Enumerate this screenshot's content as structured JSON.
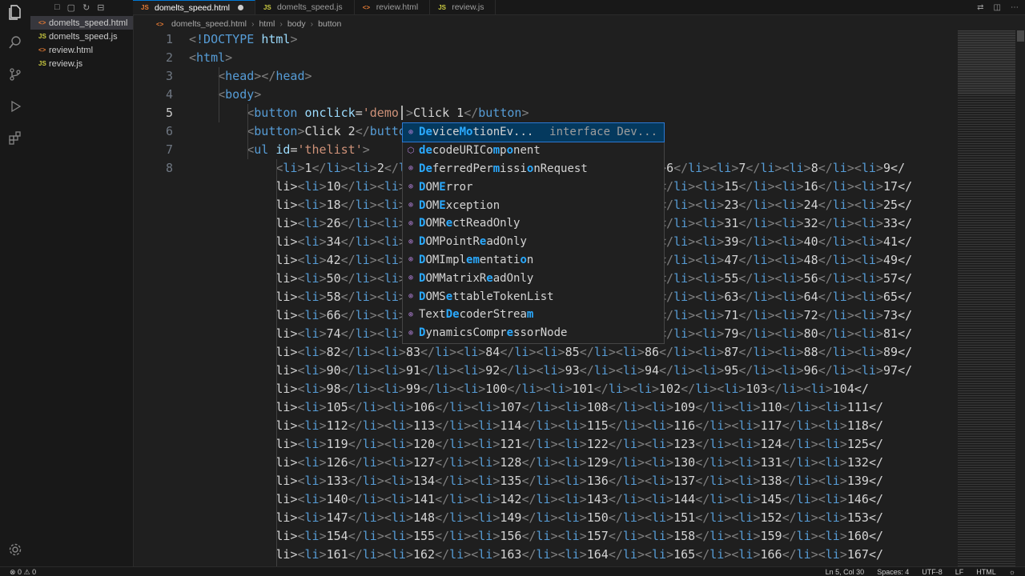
{
  "editor_tabs": [
    {
      "icon": "JS",
      "label": "domelts_speed.html",
      "active": true,
      "unsaved": true
    },
    {
      "icon": "JS",
      "label": "domelts_speed.js"
    },
    {
      "icon": "<>",
      "label": "review.html"
    },
    {
      "icon": "JS",
      "label": "review.js"
    }
  ],
  "explorer": {
    "files": [
      {
        "icon": "<>",
        "label": "domelts_speed.html",
        "active": true
      },
      {
        "icon": "JS",
        "label": "domelts_speed.js"
      },
      {
        "icon": "<>",
        "label": "review.html"
      },
      {
        "icon": "JS",
        "label": "review.js"
      }
    ]
  },
  "breadcrumb": {
    "file": "domelts_speed.html",
    "items": [
      "html",
      "body",
      "button"
    ]
  },
  "code_lines": [
    {
      "n": "1",
      "text": "<!DOCTYPE html>"
    },
    {
      "n": "2",
      "text": "<html>"
    },
    {
      "n": "3",
      "text": "    <head></head>"
    },
    {
      "n": "4",
      "text": "    <body>"
    },
    {
      "n": "5",
      "text": "        <button onclick='demo'>Click 1</button>"
    },
    {
      "n": "6",
      "text": "        <button>Click 2</button>"
    },
    {
      "n": "7",
      "text": "        <ul id='thelist'>"
    },
    {
      "n": "8",
      "text": "            <li>1</li><li>2</li><li>3</li><li>4</li><li>5</li><li>6</li><li>7</li><li>8</li><li>9</"
    },
    {
      "n": "",
      "text": "            li><li>10</li><li>11</li><li>12</li><li>13</li><li>14</li><li>15</li><li>16</li><li>17</"
    },
    {
      "n": "",
      "text": "            li><li>18</li><li>19</li><li>20</li><li>21</li><li>22</li><li>23</li><li>24</li><li>25</"
    },
    {
      "n": "",
      "text": "            li><li>26</li><li>27</li><li>28</li><li>29</li><li>30</li><li>31</li><li>32</li><li>33</"
    },
    {
      "n": "",
      "text": "            li><li>34</li><li>35</li><li>36</li><li>37</li><li>38</li><li>39</li><li>40</li><li>41</"
    },
    {
      "n": "",
      "text": "            li><li>42</li><li>43</li><li>44</li><li>45</li><li>46</li><li>47</li><li>48</li><li>49</"
    },
    {
      "n": "",
      "text": "            li><li>50</li><li>51</li><li>52</li><li>53</li><li>54</li><li>55</li><li>56</li><li>57</"
    },
    {
      "n": "",
      "text": "            li><li>58</li><li>59</li><li>60</li><li>61</li><li>62</li><li>63</li><li>64</li><li>65</"
    },
    {
      "n": "",
      "text": "            li><li>66</li><li>67</li><li>68</li><li>69</li><li>70</li><li>71</li><li>72</li><li>73</"
    },
    {
      "n": "",
      "text": "            li><li>74</li><li>75</li><li>76</li><li>77</li><li>78</li><li>79</li><li>80</li><li>81</"
    },
    {
      "n": "",
      "text": "            li><li>82</li><li>83</li><li>84</li><li>85</li><li>86</li><li>87</li><li>88</li><li>89</"
    },
    {
      "n": "",
      "text": "            li><li>90</li><li>91</li><li>92</li><li>93</li><li>94</li><li>95</li><li>96</li><li>97</"
    },
    {
      "n": "",
      "text": "            li><li>98</li><li>99</li><li>100</li><li>101</li><li>102</li><li>103</li><li>104</"
    },
    {
      "n": "",
      "text": "            li><li>105</li><li>106</li><li>107</li><li>108</li><li>109</li><li>110</li><li>111</"
    },
    {
      "n": "",
      "text": "            li><li>112</li><li>113</li><li>114</li><li>115</li><li>116</li><li>117</li><li>118</"
    },
    {
      "n": "",
      "text": "            li><li>119</li><li>120</li><li>121</li><li>122</li><li>123</li><li>124</li><li>125</"
    },
    {
      "n": "",
      "text": "            li><li>126</li><li>127</li><li>128</li><li>129</li><li>130</li><li>131</li><li>132</"
    },
    {
      "n": "",
      "text": "            li><li>133</li><li>134</li><li>135</li><li>136</li><li>137</li><li>138</li><li>139</"
    },
    {
      "n": "",
      "text": "            li><li>140</li><li>141</li><li>142</li><li>143</li><li>144</li><li>145</li><li>146</"
    },
    {
      "n": "",
      "text": "            li><li>147</li><li>148</li><li>149</li><li>150</li><li>151</li><li>152</li><li>153</"
    },
    {
      "n": "",
      "text": "            li><li>154</li><li>155</li><li>156</li><li>157</li><li>158</li><li>159</li><li>160</"
    },
    {
      "n": "",
      "text": "            li><li>161</li><li>162</li><li>163</li><li>164</li><li>165</li><li>166</li><li>167</"
    }
  ],
  "suggestions": [
    {
      "icon": "class",
      "label": "DeviceMotionEv...",
      "detail": "interface Dev...",
      "selected": true
    },
    {
      "icon": "function",
      "label": "decodeURIComponent"
    },
    {
      "icon": "class",
      "label": "DeferredPermissionRequest"
    },
    {
      "icon": "class",
      "label": "DOMError"
    },
    {
      "icon": "class",
      "label": "DOMException"
    },
    {
      "icon": "class",
      "label": "DOMRectReadOnly"
    },
    {
      "icon": "class",
      "label": "DOMPointReadOnly"
    },
    {
      "icon": "class",
      "label": "DOMImplementation"
    },
    {
      "icon": "class",
      "label": "DOMMatrixReadOnly"
    },
    {
      "icon": "class",
      "label": "DOMSettableTokenList"
    },
    {
      "icon": "class",
      "label": "TextDecoderStream"
    },
    {
      "icon": "class",
      "label": "DynamicsCompressorNode"
    }
  ],
  "status_bar": {
    "errors": "0",
    "warnings": "0",
    "position": "Ln 5, Col 30",
    "indent": "Spaces: 4",
    "encoding": "UTF-8",
    "eol": "LF",
    "language": "HTML"
  }
}
